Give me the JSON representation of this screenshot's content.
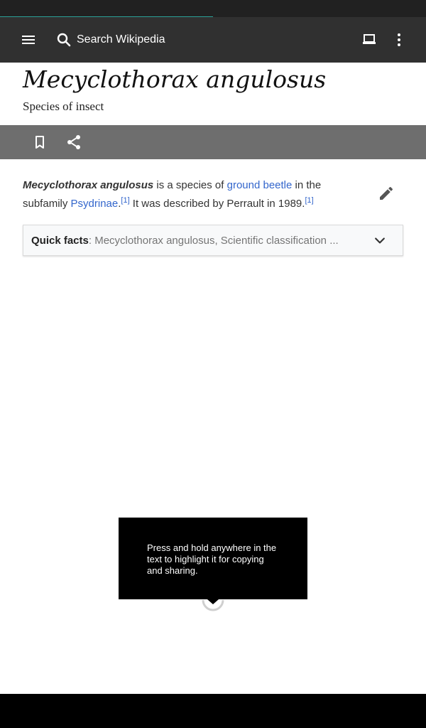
{
  "status_bar": {},
  "page_load": {
    "progress": 0.5,
    "color": "#2aa198"
  },
  "toolbar": {
    "menu_icon": "hamburger-menu-icon",
    "search_icon": "search-icon",
    "search_placeholder": "Search Wikipedia",
    "tabs_icon": "tabs-icon",
    "overflow_icon": "more-vert-icon"
  },
  "article": {
    "title": "Mecyclothorax angulosus",
    "description": "Species of insect",
    "lead": {
      "term": "Mecyclothorax angulosus",
      "t1": " is a species of ",
      "link1": "ground beetle",
      "t2": " in the subfamily ",
      "link2": "Psydrinae",
      "t3": ".",
      "ref1": "[1]",
      "t4": " It was described by Perrault in 1989.",
      "ref2": "[1]"
    }
  },
  "action_bar": {
    "bookmark_icon": "bookmark-icon",
    "share_icon": "share-icon"
  },
  "edit_icon": "pencil-icon",
  "quick_facts": {
    "label": "Quick facts",
    "summary": ": Mecyclothorax angulosus, Scientific classification ...",
    "chevron_icon": "chevron-down-icon"
  },
  "tooltip": {
    "text": "Press and hold anywhere in the text to highlight it for copying and sharing."
  },
  "colors": {
    "toolbar": "#303030",
    "action_bar": "#6e6e6e",
    "link": "#3366cc"
  }
}
